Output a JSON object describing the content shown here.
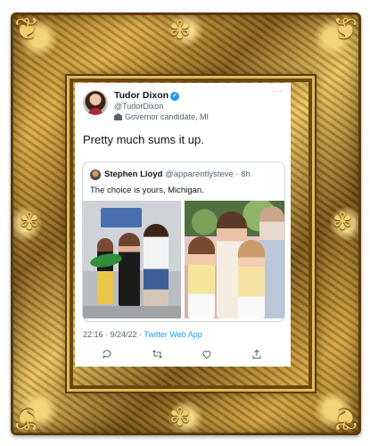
{
  "tweet": {
    "author_name": "Tudor Dixon",
    "author_handle": "@TudorDixon",
    "author_label": "Governor candidate, MI",
    "more_icon": "more-icon",
    "text": "Pretty much sums it up.",
    "timestamp": "22:16 · 9/24/22",
    "source": "Twitter Web App",
    "quote": {
      "author_name": "Stephen Lloyd",
      "author_handle": "@apparentlysteve",
      "age": "8h",
      "text": "The choice is yours, Michigan."
    },
    "actions": [
      "reply-icon",
      "retweet-icon",
      "like-icon",
      "share-icon"
    ]
  },
  "colors": {
    "link": "#1d9bf0",
    "secondary_text": "#536471",
    "frame_gold": "#d9a942"
  }
}
